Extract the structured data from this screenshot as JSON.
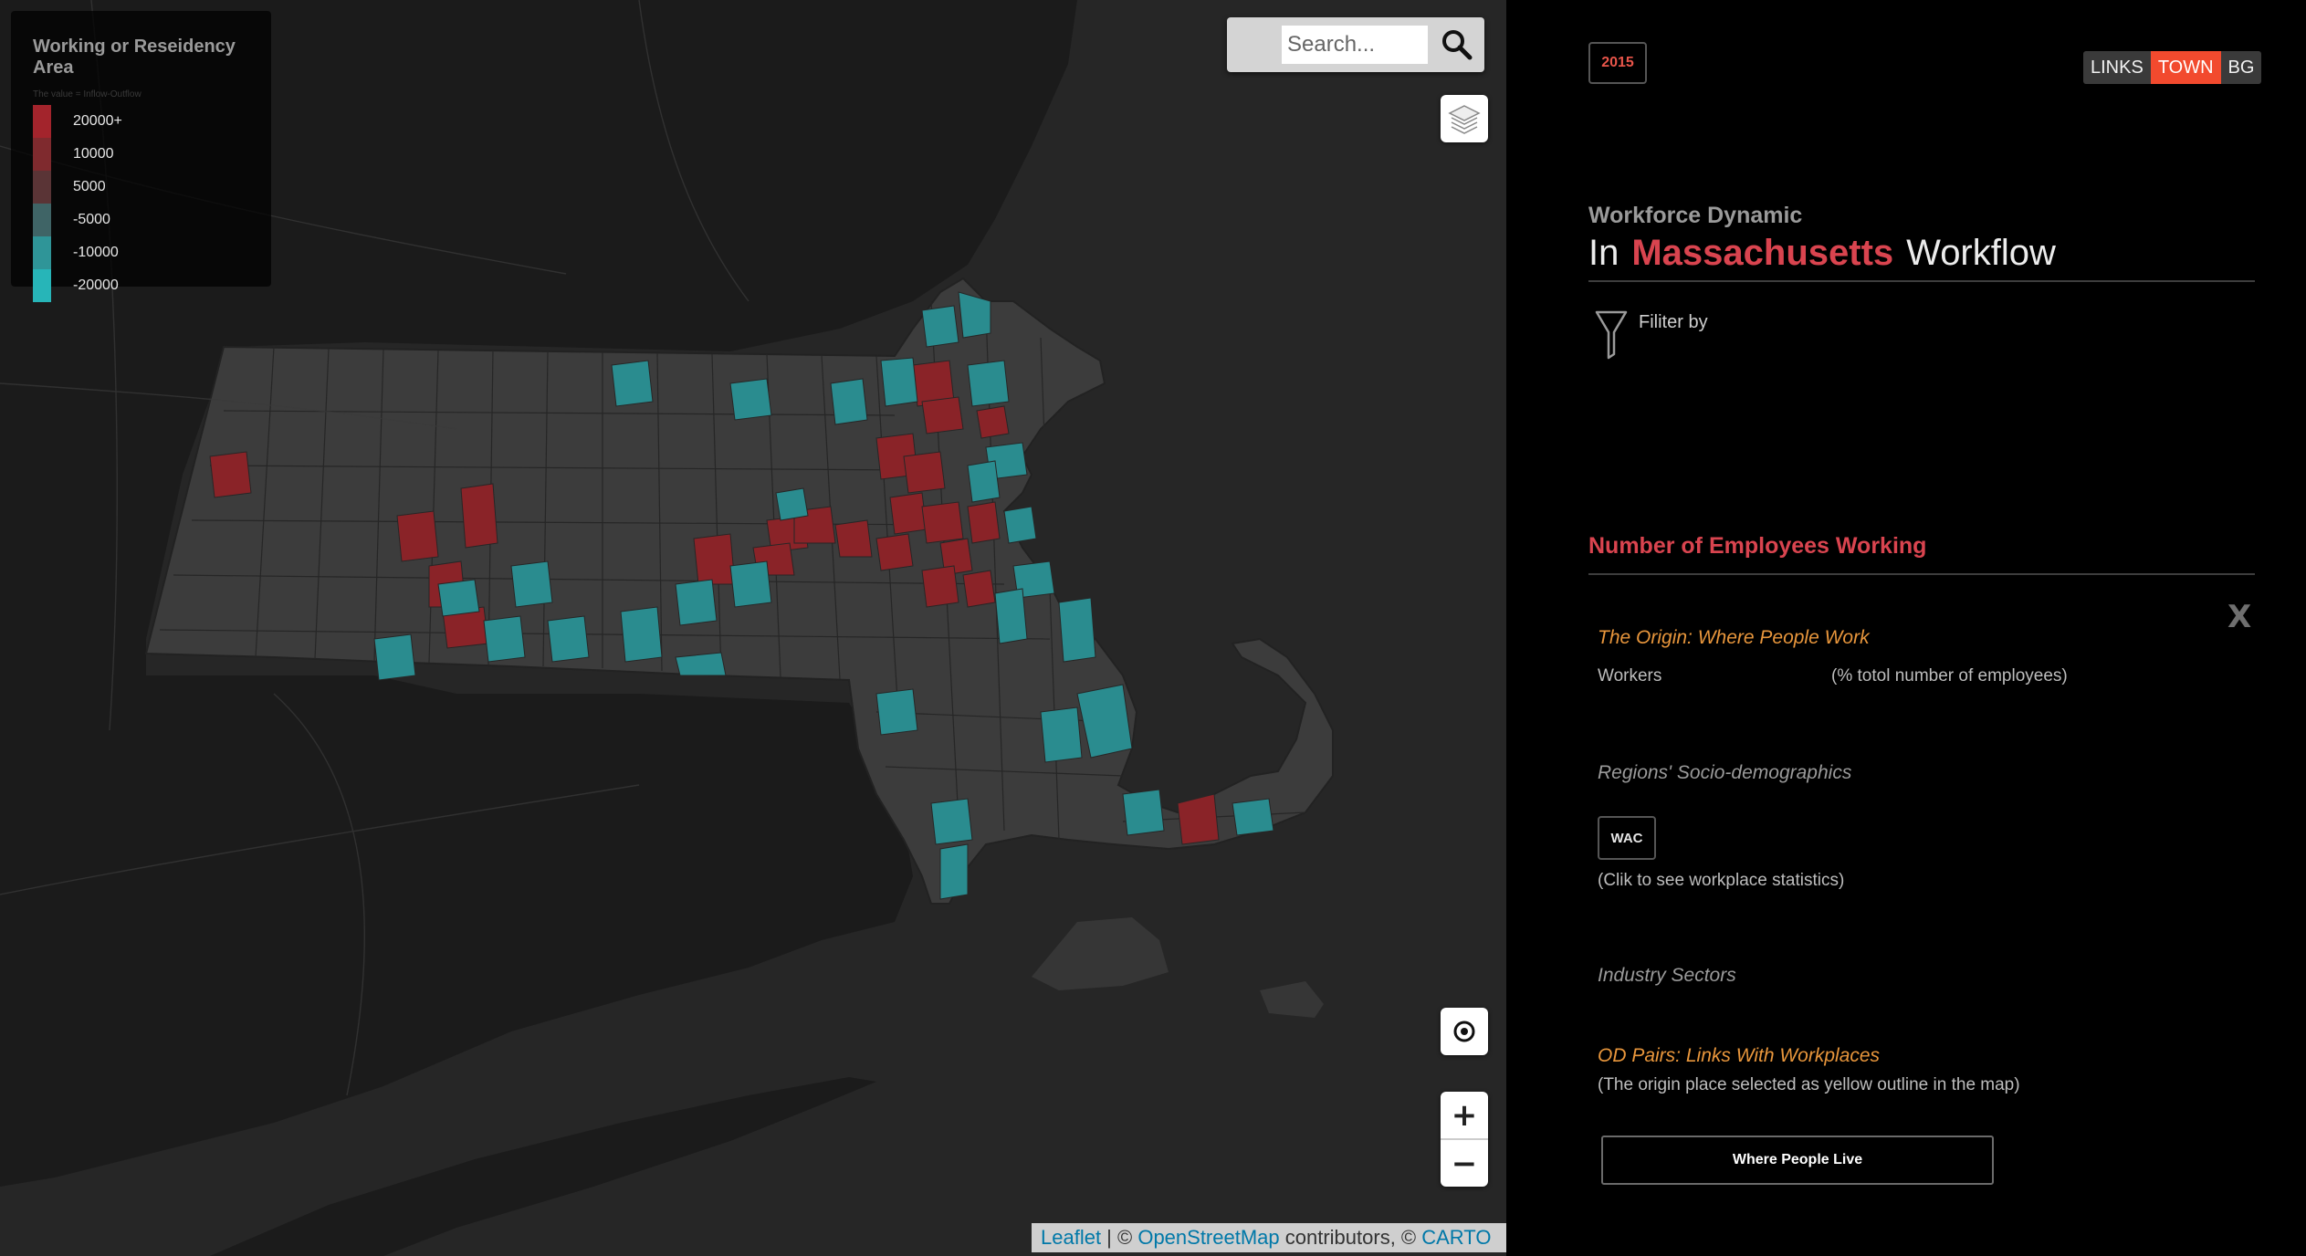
{
  "legend": {
    "title": "Working or Reseidency Area",
    "subtitle": "The value = Inflow-Outflow",
    "items": [
      {
        "label": "20000+",
        "color": "#a3242c"
      },
      {
        "label": "10000",
        "color": "#7f2a2e"
      },
      {
        "label": "5000",
        "color": "#5a3436"
      },
      {
        "label": "-5000",
        "color": "#3f6466"
      },
      {
        "label": "-10000",
        "color": "#2f9598"
      },
      {
        "label": "-20000",
        "color": "#27b5b8"
      }
    ]
  },
  "search": {
    "placeholder": "Search...",
    "icon": "magnifier-icon"
  },
  "map_controls": {
    "layers_icon": "layers-icon",
    "locate_icon": "locate-icon",
    "zoom_in": "+",
    "zoom_out": "−"
  },
  "attribution": {
    "leaflet": "Leaflet",
    "sep1": " | © ",
    "osm": "OpenStreetMap",
    "contributors": " contributors, © ",
    "carto": "CARTO"
  },
  "panel": {
    "year": "2015",
    "levels": [
      "LINKS",
      "TOWN",
      "BG"
    ],
    "active_level": "TOWN",
    "kicker": "Workforce Dynamic",
    "title_prefix": "In",
    "title_state": "Massachusetts",
    "title_suffix": "Workflow",
    "filter_label": "Filiter by",
    "employees_heading": "Number of Employees Working",
    "close_label": "X",
    "origin_title": "The Origin: Where People Work",
    "workers_label": "Workers",
    "workers_pct": "(% totol number of employees)",
    "socio_title": "Regions' Socio-demographics",
    "wac_label": "WAC",
    "wac_hint": "(Clik to see workplace statistics)",
    "industry_title": "Industry Sectors",
    "od_title": "OD Pairs: Links With Workplaces",
    "od_hint": "(The origin place selected as yellow outline in the map)",
    "live_button": "Where People Live"
  },
  "colors": {
    "accent_red": "#d9444f",
    "toggle_active": "#f24a2e",
    "section_orange": "#e8963c"
  }
}
